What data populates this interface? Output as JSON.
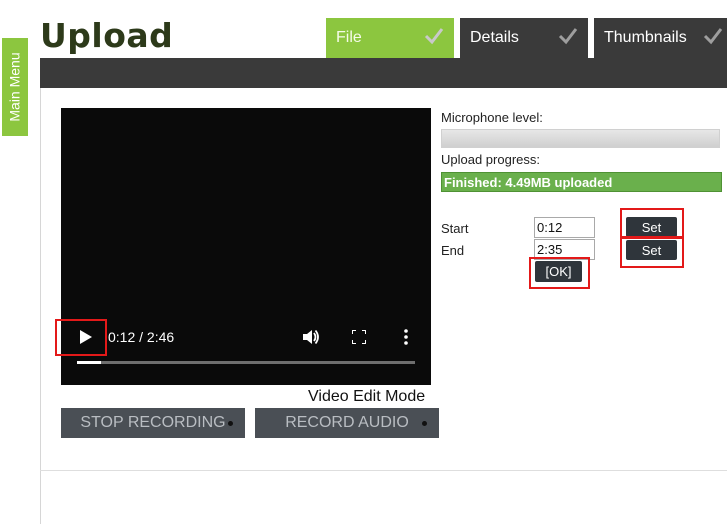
{
  "sidebar": {
    "main_menu_label": "Main Menu"
  },
  "header": {
    "title": "Upload"
  },
  "tabs": [
    {
      "label": "File",
      "completed": true
    },
    {
      "label": "Details",
      "completed": true
    },
    {
      "label": "Thumbnails",
      "completed": true
    }
  ],
  "player": {
    "current_time": "0:12",
    "duration": "2:46",
    "time_display": "0:12 / 2:46",
    "progress_fraction": 0.07
  },
  "video_edit_mode_label": "Video Edit Mode",
  "buttons": {
    "stop_recording": "STOP RECORDING",
    "record_audio": "RECORD AUDIO"
  },
  "panel": {
    "microphone_label": "Microphone level:",
    "upload_progress_label": "Upload progress:",
    "upload_status": "Finished: 4.49MB uploaded",
    "upload_fraction": 1.0,
    "start_label": "Start",
    "end_label": "End",
    "start_value": "0:12",
    "end_value": "2:35",
    "set_label": "Set",
    "ok_label": "[OK]"
  },
  "colors": {
    "accent_green": "#8cc63f",
    "dark_bar": "#3a3a3a",
    "upload_green": "#6ab04c",
    "highlight_red": "#e31919"
  }
}
